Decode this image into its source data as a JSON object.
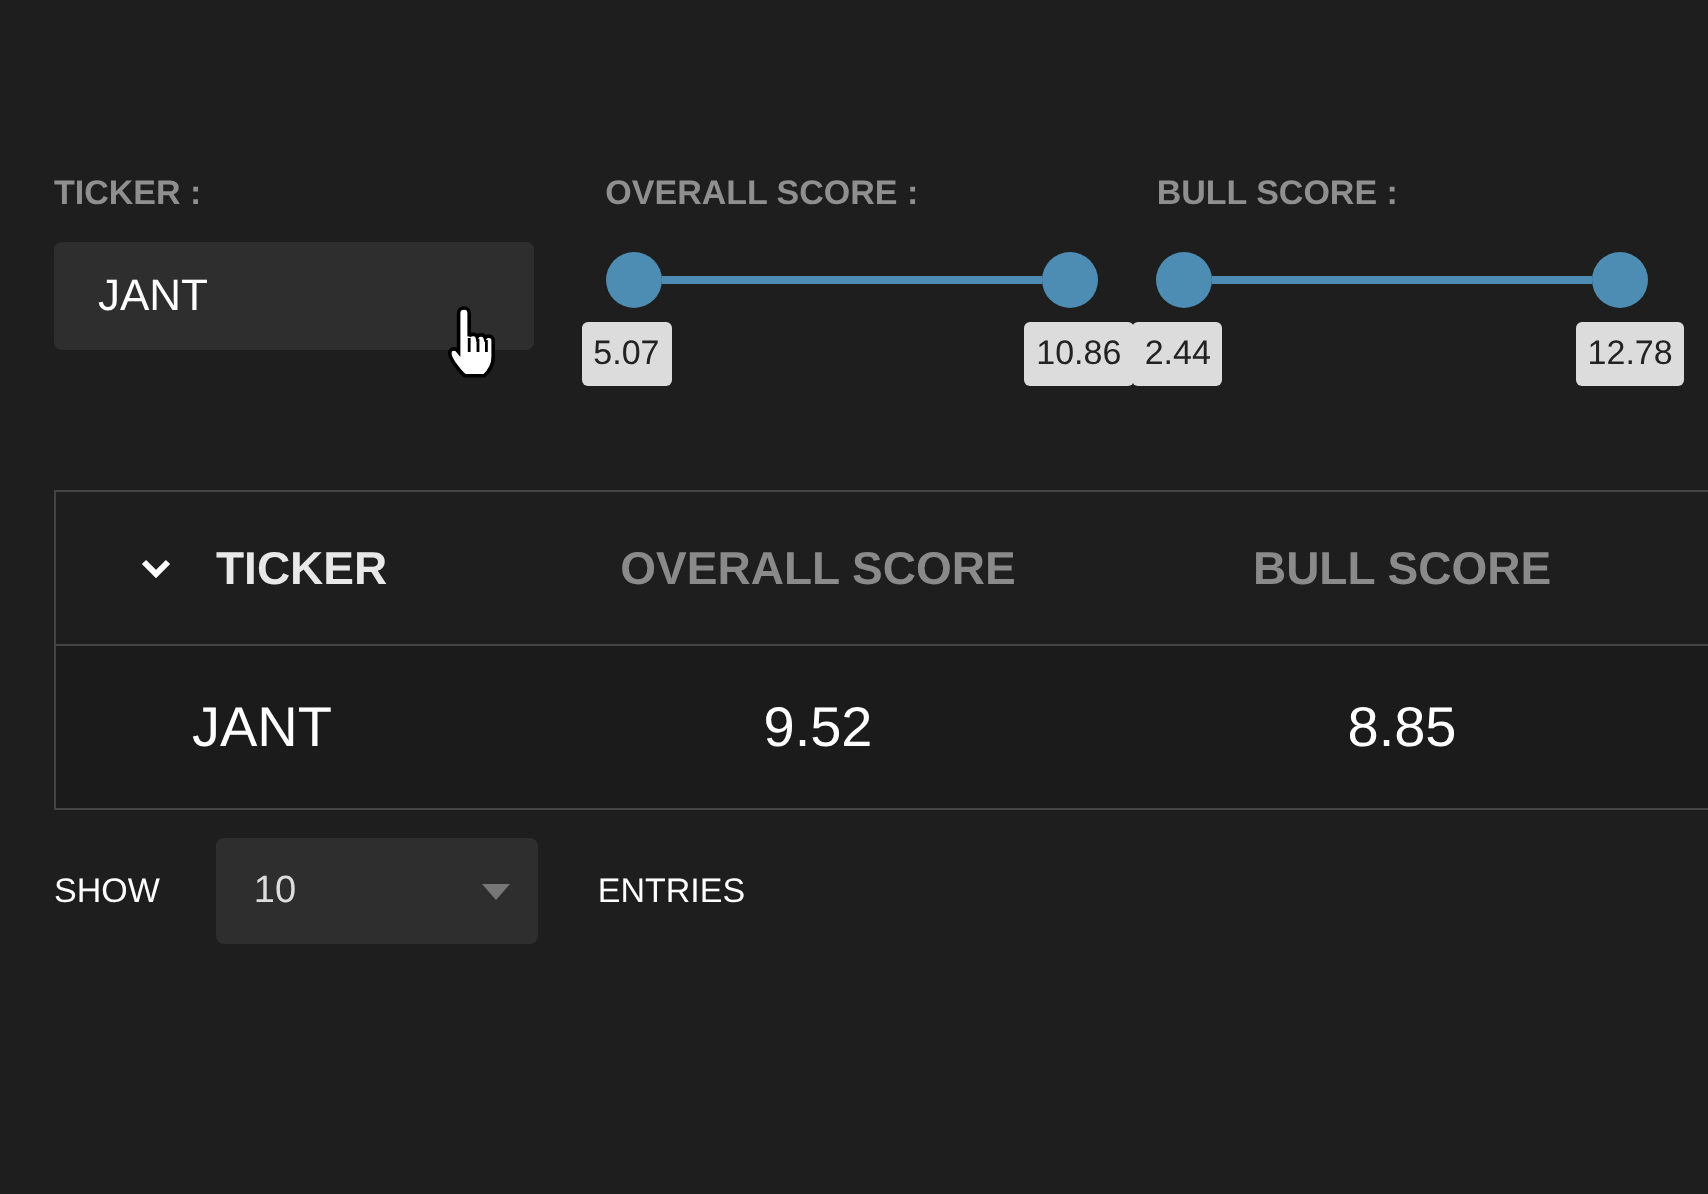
{
  "filters": [
    {
      "kind": "text",
      "label": "TICKER :",
      "value": "JANT"
    },
    {
      "kind": "range",
      "label": "OVERALL SCORE :",
      "min_label": "5.07",
      "max_label": "10.86"
    },
    {
      "kind": "range",
      "label": "BULL SCORE :",
      "min_label": "2.44",
      "max_label": "12.78"
    }
  ],
  "table": {
    "columns": [
      {
        "label": "TICKER",
        "sorted": true
      },
      {
        "label": "OVERALL SCORE",
        "sorted": false
      },
      {
        "label": "BULL SCORE",
        "sorted": false
      }
    ],
    "rows": [
      [
        "JANT",
        "9.52",
        "8.85"
      ]
    ]
  },
  "page_length": {
    "before": "SHOW",
    "value": "10",
    "after": "ENTRIES"
  }
}
